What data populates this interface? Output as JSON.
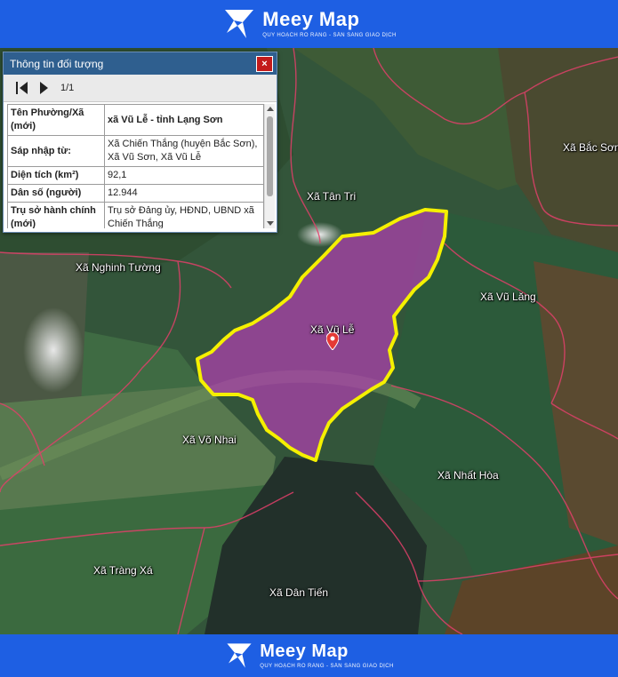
{
  "brand": {
    "name": "Meey Map",
    "tagline": "QUY HOẠCH RÕ RÀNG - SẴN SÀNG GIAO DỊCH"
  },
  "panel": {
    "title": "Thông tin đối tượng",
    "close_label": "×",
    "page_indicator": "1/1",
    "rows": [
      {
        "key": "Tên Phường/Xã (mới)",
        "value": "xã Vũ Lễ - tỉnh Lạng Sơn"
      },
      {
        "key": "Sáp nhập từ:",
        "value": "Xã Chiến Thắng (huyện Bắc Sơn), Xã Vũ Sơn, Xã Vũ Lễ"
      },
      {
        "key": "Diện tích (km²)",
        "value": "92,1"
      },
      {
        "key": "Dân số (người)",
        "value": "12.944"
      },
      {
        "key": "Trụ sở hành chính (mới)",
        "value": "Trụ sở Đảng ủy, HĐND, UBND xã Chiến Thắng"
      }
    ]
  },
  "map": {
    "highlight_color": "#f5f000",
    "highlight_fill": "#b040b0",
    "labels": {
      "bac_son": "Xã Bắc Sơn",
      "tan_tri": "Xã Tân Tri",
      "nghinh_tuong": "Xã Nghinh Tường",
      "vu_lang": "Xã Vũ Lăng",
      "vu_le": "Xã Vũ Lễ",
      "vo_nhai": "Xã Võ Nhai",
      "nhat_hoa": "Xã Nhất Hòa",
      "trang_xa": "Xã Tràng Xá",
      "dan_tien": "Xã Dân Tiến"
    }
  }
}
